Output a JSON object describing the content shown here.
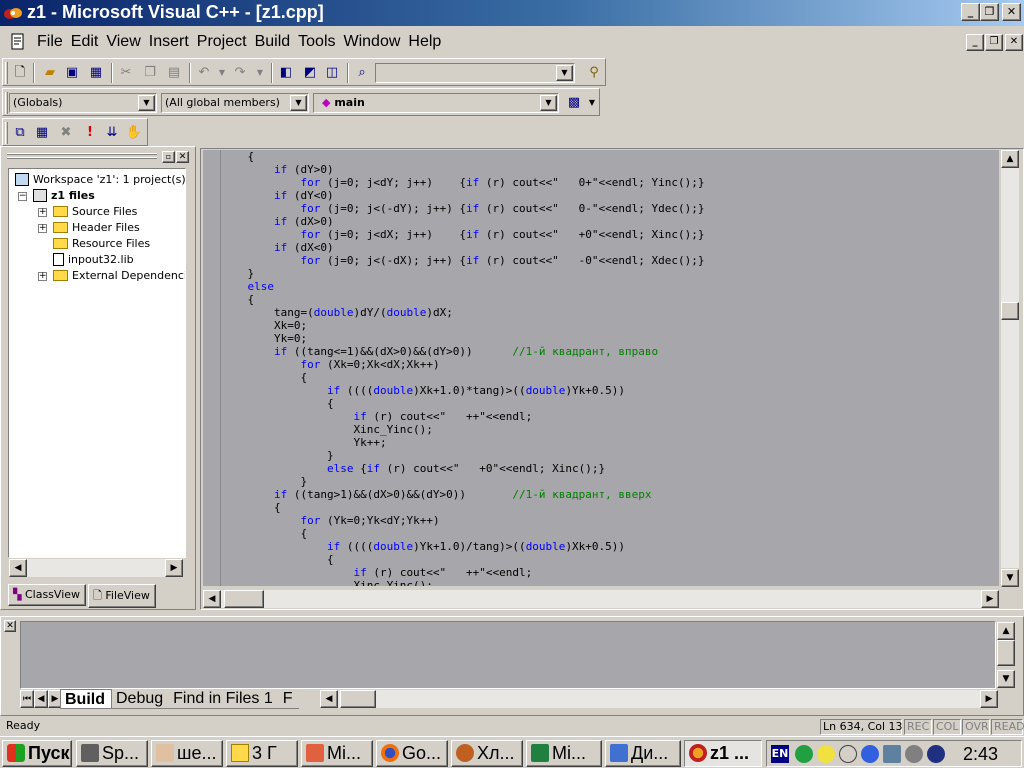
{
  "window": {
    "title": "z1 - Microsoft Visual C++ - [z1.cpp]",
    "caption_min": "_",
    "caption_restore": "❐",
    "caption_close": "✕"
  },
  "menu": [
    "File",
    "Edit",
    "View",
    "Insert",
    "Project",
    "Build",
    "Tools",
    "Window",
    "Help"
  ],
  "wizardbar": {
    "scope": "(Globals)",
    "members": "(All global members)",
    "function": "main"
  },
  "workspace": {
    "root": "Workspace 'z1': 1 project(s)",
    "project": "z1 files",
    "items": [
      "Source Files",
      "Header Files",
      "Resource Files",
      "inpout32.lib",
      "External Dependencies"
    ],
    "tabs": [
      "ClassView",
      "FileView"
    ]
  },
  "code": [
    [
      [
        "",
        "    {"
      ]
    ],
    [
      [
        "",
        "        "
      ],
      [
        "kw",
        "if"
      ],
      [
        "",
        " (dY>0)"
      ]
    ],
    [
      [
        "",
        "            "
      ],
      [
        "kw",
        "for"
      ],
      [
        "",
        " (j=0; j<dY; j++)    {"
      ],
      [
        "kw",
        "if"
      ],
      [
        "",
        " (r) cout<<\"   0+\"<<endl; Yinc();}"
      ]
    ],
    [
      [
        "",
        "        "
      ],
      [
        "kw",
        "if"
      ],
      [
        "",
        " (dY<0)"
      ]
    ],
    [
      [
        "",
        "            "
      ],
      [
        "kw",
        "for"
      ],
      [
        "",
        " (j=0; j<(-dY); j++) {"
      ],
      [
        "kw",
        "if"
      ],
      [
        "",
        " (r) cout<<\"   0-\"<<endl; Ydec();}"
      ]
    ],
    [
      [
        "",
        "        "
      ],
      [
        "kw",
        "if"
      ],
      [
        "",
        " (dX>0)"
      ]
    ],
    [
      [
        "",
        "            "
      ],
      [
        "kw",
        "for"
      ],
      [
        "",
        " (j=0; j<dX; j++)    {"
      ],
      [
        "kw",
        "if"
      ],
      [
        "",
        " (r) cout<<\"   +0\"<<endl; Xinc();}"
      ]
    ],
    [
      [
        "",
        "        "
      ],
      [
        "kw",
        "if"
      ],
      [
        "",
        " (dX<0)"
      ]
    ],
    [
      [
        "",
        "            "
      ],
      [
        "kw",
        "for"
      ],
      [
        "",
        " (j=0; j<(-dX); j++) {"
      ],
      [
        "kw",
        "if"
      ],
      [
        "",
        " (r) cout<<\"   -0\"<<endl; Xdec();}"
      ]
    ],
    [
      [
        "",
        "    }"
      ]
    ],
    [
      [
        "",
        "    "
      ],
      [
        "kw",
        "else"
      ]
    ],
    [
      [
        "",
        "    {"
      ]
    ],
    [
      [
        "",
        "        tang=("
      ],
      [
        "kw",
        "double"
      ],
      [
        "",
        ")dY/("
      ],
      [
        "kw",
        "double"
      ],
      [
        "",
        ")dX;"
      ]
    ],
    [
      [
        "",
        "        Xk=0;"
      ]
    ],
    [
      [
        "",
        "        Yk=0;"
      ]
    ],
    [
      [
        "",
        "        "
      ],
      [
        "kw",
        "if"
      ],
      [
        "",
        " ((tang<=1)&&(dX>0)&&(dY>0))      "
      ],
      [
        "cm",
        "//1-й квадрант, вправо"
      ]
    ],
    [
      [
        "",
        "            "
      ],
      [
        "kw",
        "for"
      ],
      [
        "",
        " (Xk=0;Xk<dX;Xk++)"
      ]
    ],
    [
      [
        "",
        "            {"
      ]
    ],
    [
      [
        "",
        "                "
      ],
      [
        "kw",
        "if"
      ],
      [
        "",
        " (((("
      ],
      [
        "kw",
        "double"
      ],
      [
        "",
        ")Xk+1.0)*tang)>(("
      ],
      [
        "kw",
        "double"
      ],
      [
        "",
        ")Yk+0.5))"
      ]
    ],
    [
      [
        "",
        "                {"
      ]
    ],
    [
      [
        "",
        "                    "
      ],
      [
        "kw",
        "if"
      ],
      [
        "",
        " (r) cout<<\"   ++\"<<endl;"
      ]
    ],
    [
      [
        "",
        "                    Xinc_Yinc();"
      ]
    ],
    [
      [
        "",
        "                    Yk++;"
      ]
    ],
    [
      [
        "",
        "                }"
      ]
    ],
    [
      [
        "",
        "                "
      ],
      [
        "kw",
        "else"
      ],
      [
        "",
        " {"
      ],
      [
        "kw",
        "if"
      ],
      [
        "",
        " (r) cout<<\"   +0\"<<endl; Xinc();}"
      ]
    ],
    [
      [
        "",
        "            }"
      ]
    ],
    [
      [
        "",
        "        "
      ],
      [
        "kw",
        "if"
      ],
      [
        "",
        " ((tang>1)&&(dX>0)&&(dY>0))       "
      ],
      [
        "cm",
        "//1-й квадрант, вверх"
      ]
    ],
    [
      [
        "",
        "        {"
      ]
    ],
    [
      [
        "",
        "            "
      ],
      [
        "kw",
        "for"
      ],
      [
        "",
        " (Yk=0;Yk<dY;Yk++)"
      ]
    ],
    [
      [
        "",
        "            {"
      ]
    ],
    [
      [
        "",
        "                "
      ],
      [
        "kw",
        "if"
      ],
      [
        "",
        " (((("
      ],
      [
        "kw",
        "double"
      ],
      [
        "",
        ")Yk+1.0)/tang)>(("
      ],
      [
        "kw",
        "double"
      ],
      [
        "",
        ")Xk+0.5))"
      ]
    ],
    [
      [
        "",
        "                {"
      ]
    ],
    [
      [
        "",
        "                    "
      ],
      [
        "kw",
        "if"
      ],
      [
        "",
        " (r) cout<<\"   ++\"<<endl;"
      ]
    ],
    [
      [
        "",
        "                    Xinc_Yinc();"
      ]
    ]
  ],
  "output": {
    "tabs": [
      "Build",
      "Debug",
      "Find in Files 1",
      "F"
    ]
  },
  "status": {
    "text": "Ready",
    "position": "Ln 634, Col 13",
    "indicators": [
      "REC",
      "COL",
      "OVR",
      "READ"
    ]
  },
  "taskbar": {
    "start": "Пуск",
    "tasks": [
      "Sp...",
      "ше...",
      "3 Г",
      "Mi...",
      "Go...",
      "Хл...",
      "Mi...",
      "Ди...",
      "z1 ..."
    ],
    "tray_lang": "EN",
    "clock": "2:43"
  }
}
